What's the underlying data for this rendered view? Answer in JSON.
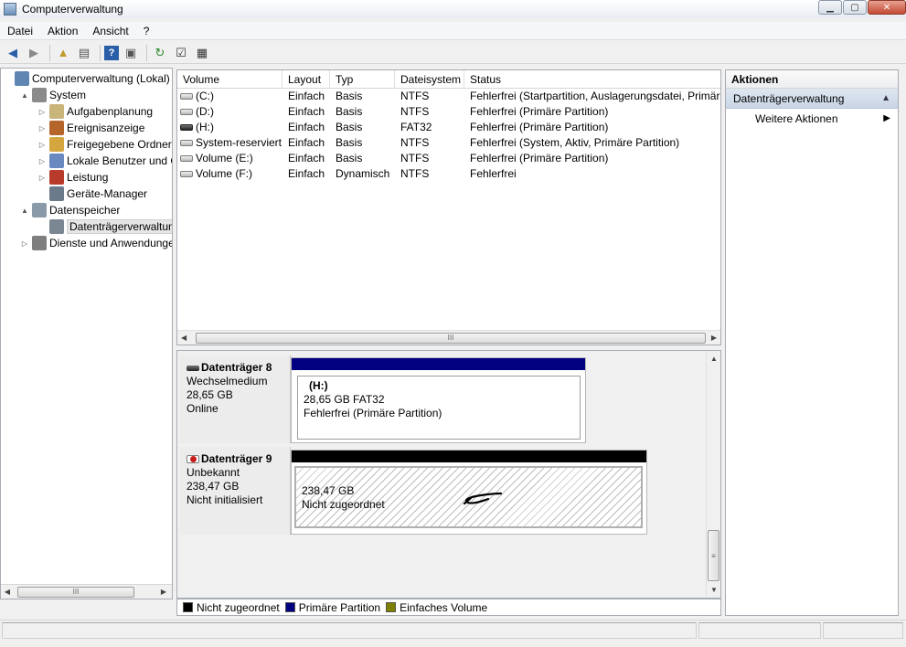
{
  "window": {
    "title": "Computerverwaltung"
  },
  "menu": [
    "Datei",
    "Aktion",
    "Ansicht",
    "?"
  ],
  "tree": {
    "items": [
      {
        "label": "Computerverwaltung (Lokal)",
        "icon": "computer-management-icon",
        "expander": "",
        "depth": 0,
        "selected": false
      },
      {
        "label": "System",
        "icon": "tools-icon",
        "expander": "▲",
        "depth": 1,
        "selected": false
      },
      {
        "label": "Aufgabenplanung",
        "icon": "clock-icon",
        "expander": "▷",
        "depth": 2,
        "selected": false
      },
      {
        "label": "Ereignisanzeige",
        "icon": "event-viewer-icon",
        "expander": "▷",
        "depth": 2,
        "selected": false
      },
      {
        "label": "Freigegebene Ordner",
        "icon": "shared-folder-icon",
        "expander": "▷",
        "depth": 2,
        "selected": false
      },
      {
        "label": "Lokale Benutzer und Gru",
        "icon": "users-icon",
        "expander": "▷",
        "depth": 2,
        "selected": false
      },
      {
        "label": "Leistung",
        "icon": "performance-icon",
        "expander": "▷",
        "depth": 2,
        "selected": false
      },
      {
        "label": "Geräte-Manager",
        "icon": "device-manager-icon",
        "expander": "",
        "depth": 2,
        "selected": false
      },
      {
        "label": "Datenspeicher",
        "icon": "storage-icon",
        "expander": "▲",
        "depth": 1,
        "selected": false
      },
      {
        "label": "Datenträgerverwaltung",
        "icon": "disk-management-icon",
        "expander": "",
        "depth": 2,
        "selected": true
      },
      {
        "label": "Dienste und Anwendungen",
        "icon": "services-icon",
        "expander": "▷",
        "depth": 1,
        "selected": false
      }
    ],
    "scroll_thumb_label": "III"
  },
  "volume_list": {
    "columns": [
      "Volume",
      "Layout",
      "Typ",
      "Dateisystem",
      "Status"
    ],
    "rows": [
      {
        "volume": "(C:)",
        "layout": "Einfach",
        "type": "Basis",
        "fs": "NTFS",
        "status": "Fehlerfrei (Startpartition, Auslagerungsdatei, Primäre",
        "icon": "drive-icon"
      },
      {
        "volume": "(D:)",
        "layout": "Einfach",
        "type": "Basis",
        "fs": "NTFS",
        "status": "Fehlerfrei (Primäre Partition)",
        "icon": "drive-icon"
      },
      {
        "volume": "(H:)",
        "layout": "Einfach",
        "type": "Basis",
        "fs": "FAT32",
        "status": "Fehlerfrei (Primäre Partition)",
        "icon": "removable-drive-icon"
      },
      {
        "volume": "System-reserviert",
        "layout": "Einfach",
        "type": "Basis",
        "fs": "NTFS",
        "status": "Fehlerfrei (System, Aktiv, Primäre Partition)",
        "icon": "drive-icon"
      },
      {
        "volume": "Volume (E:)",
        "layout": "Einfach",
        "type": "Basis",
        "fs": "NTFS",
        "status": "Fehlerfrei (Primäre Partition)",
        "icon": "drive-icon"
      },
      {
        "volume": "Volume (F:)",
        "layout": "Einfach",
        "type": "Dynamisch",
        "fs": "NTFS",
        "status": "Fehlerfrei",
        "icon": "drive-icon"
      }
    ],
    "scroll_thumb_label": "III"
  },
  "disks": [
    {
      "name": "Datenträger 8",
      "kind": "Wechselmedium",
      "size": "28,65 GB",
      "state": "Online",
      "bar_color": "#000080",
      "partition": {
        "title": "(H:)",
        "line1": "28,65 GB FAT32",
        "line2": "Fehlerfrei (Primäre Partition)"
      }
    },
    {
      "name": "Datenträger 9",
      "kind": "Unbekannt",
      "size": "238,47 GB",
      "state": "Nicht initialisiert",
      "bar_color": "#000000",
      "partition": {
        "title": "",
        "line1": "238,47 GB",
        "line2": "Nicht zugeordnet"
      }
    }
  ],
  "disk_scroll_thumb_label": "≡",
  "legend": [
    {
      "label": "Nicht zugeordnet",
      "color": "#000000"
    },
    {
      "label": "Primäre Partition",
      "color": "#000080"
    },
    {
      "label": "Einfaches Volume",
      "color": "#808000"
    }
  ],
  "actions": {
    "header": "Aktionen",
    "section": "Datenträgerverwaltung",
    "items": [
      "Weitere Aktionen"
    ]
  }
}
